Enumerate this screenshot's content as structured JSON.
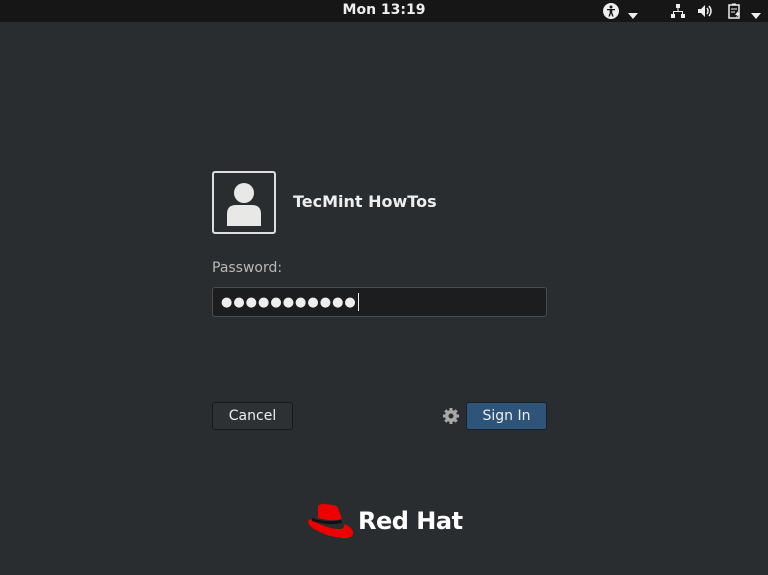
{
  "topbar": {
    "clock": "Mon 13:19",
    "icons": [
      "accessibility-icon",
      "chevron-down-icon",
      "network-icon",
      "volume-icon",
      "battery-icon",
      "chevron-down-icon"
    ]
  },
  "login": {
    "username": "TecMint HowTos",
    "password_label": "Password:",
    "password_value": "●●●●●●●●●●●",
    "cancel_label": "Cancel",
    "signin_label": "Sign In"
  },
  "branding": {
    "logo_text": "Red Hat",
    "logo_color": "#ee0000"
  }
}
